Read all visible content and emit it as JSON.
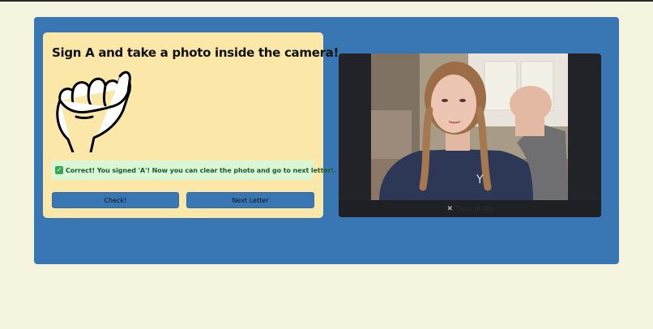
{
  "instruction": {
    "title": "Sign A and take a photo inside the camera!"
  },
  "feedback": {
    "icon": "check-mark-icon",
    "message": "Correct! You signed 'A'! Now you can clear the photo and go to next letter!."
  },
  "buttons": {
    "check_label": "Check!",
    "next_label": "Next Letter"
  },
  "camera": {
    "clear_label": "Clear photo",
    "clear_icon": "close-icon"
  },
  "colors": {
    "page_background": "#f5f4df",
    "panel_blue": "#3877b4",
    "card_yellow": "#fbe8a8",
    "success_green": "#d9f7d6"
  }
}
